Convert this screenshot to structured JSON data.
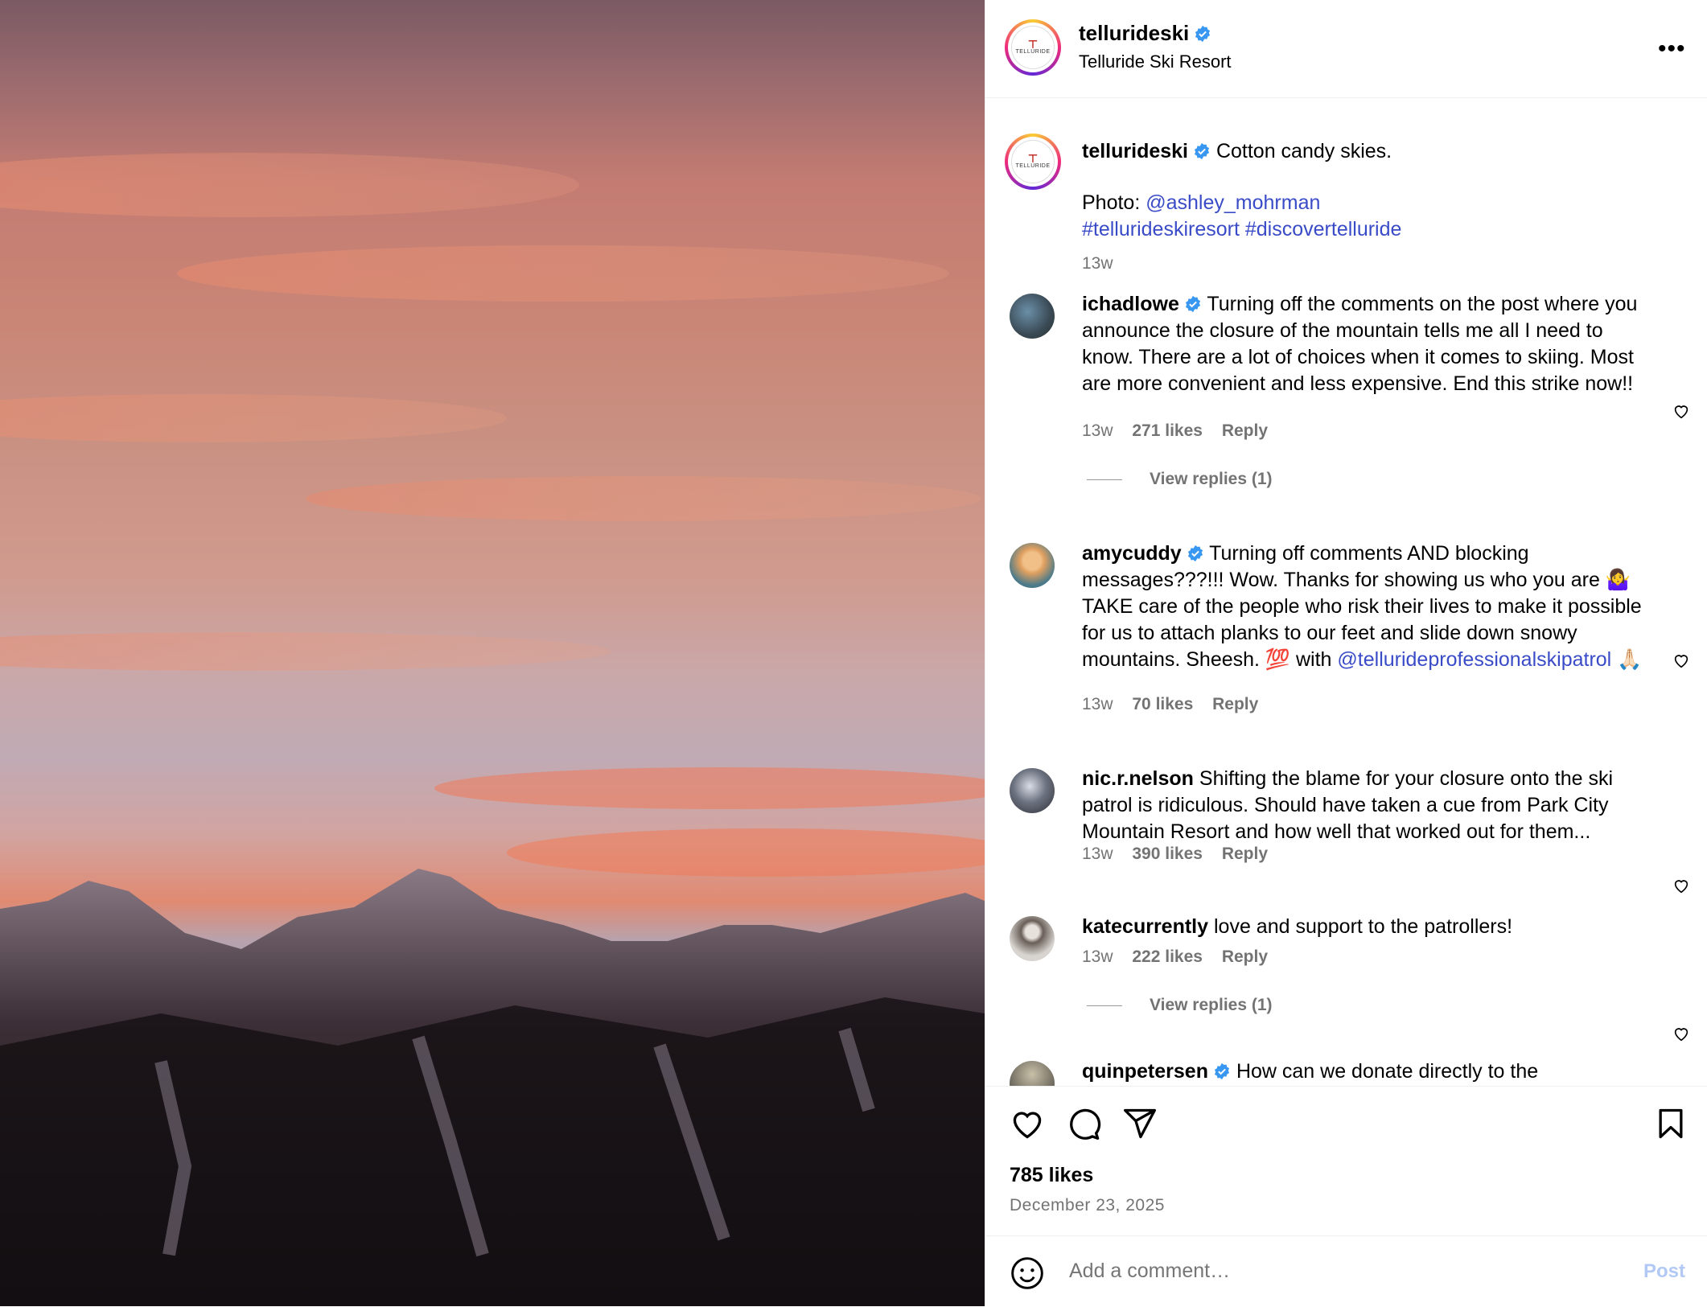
{
  "post": {
    "image_alt": "Pink sunset sky over snowy mountain ski runs",
    "header": {
      "username": "tellurideski",
      "subtitle": "Telluride Ski Resort",
      "more_icon": "more-horizontal-icon",
      "logo_text": "TELLURIDE"
    },
    "caption": {
      "username": "tellurideski",
      "text": "Cotton candy skies.",
      "photo_label": "Photo:",
      "photo_handle": "@ashley_mohrman",
      "hashtag1": "#tellurideskiresort",
      "hashtag2": "#discovertelluride",
      "time": "13w"
    },
    "comments": [
      {
        "username": "ichadlowe",
        "verified": true,
        "text": "Turning off the comments on the post where you announce the closure of the mountain tells me all I need to know. There are a lot of choices when it comes to skiing. Most are more convenient and less expensive. End this strike now!!",
        "time": "13w",
        "likes": "271 likes",
        "reply": "Reply",
        "view_replies": "View replies (1)"
      },
      {
        "username": "amycuddy",
        "verified": true,
        "text": "Turning off comments AND blocking messages???!!! Wow. Thanks for showing us who you are 🤷‍♀️ TAKE care of the people who risk their lives to make it possible for us to attach planks to our feet and slide down snowy mountains. Sheesh. 💯 with",
        "mention": "@tellurideprofessionalskipatrol",
        "mention_suffix": " 🙏🏻",
        "time": "13w",
        "likes": "70 likes",
        "reply": "Reply"
      },
      {
        "username": "nic.r.nelson",
        "verified": false,
        "text": "Shifting the blame for your closure onto the ski patrol is ridiculous. Should have taken a cue from Park City Mountain Resort and how well that worked out for them...",
        "time": "13w",
        "likes": "390 likes",
        "reply": "Reply"
      },
      {
        "username": "katecurrently",
        "verified": false,
        "text": "love and support to the patrollers!",
        "time": "13w",
        "likes": "222 likes",
        "reply": "Reply",
        "view_replies": "View replies (1)"
      },
      {
        "username": "quinpetersen",
        "verified": true,
        "text": "How can we donate directly to the"
      }
    ],
    "actions": {
      "like_icon": "heart-icon",
      "comment_icon": "comment-icon",
      "share_icon": "send-icon",
      "save_icon": "bookmark-icon"
    },
    "likes": "785 likes",
    "date": "December 23, 2025",
    "composer": {
      "emoji_icon": "emoji-icon",
      "placeholder": "Add a comment…",
      "post_label": "Post"
    },
    "colors": {
      "link": "#3a4bc8",
      "verified": "#3897f0",
      "muted": "#737373",
      "post_disabled": "#b3c9f5"
    }
  }
}
